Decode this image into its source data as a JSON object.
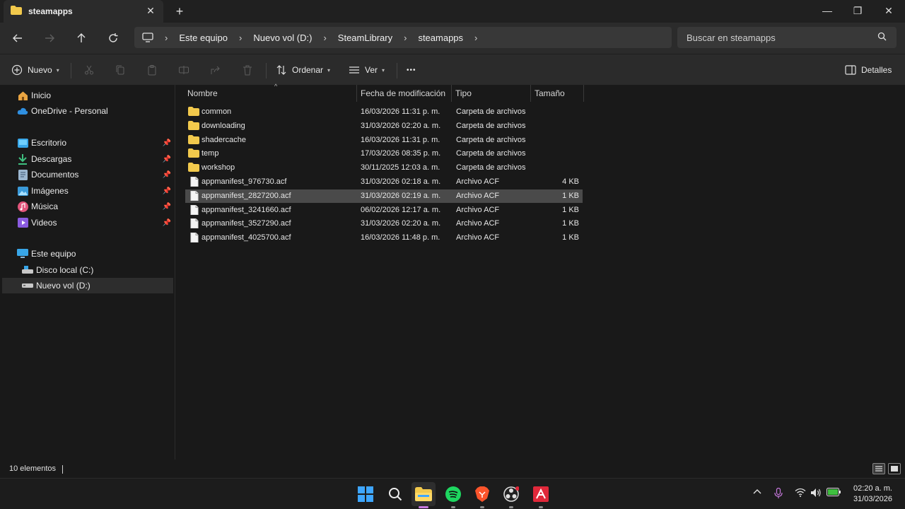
{
  "window": {
    "tab_title": "steamapps",
    "tab_close": "✕",
    "new_tab": "+",
    "minimize": "—",
    "maximize": "❐",
    "close": "✕"
  },
  "nav": {
    "breadcrumb": [
      "Este equipo",
      "Nuevo vol (D:)",
      "SteamLibrary",
      "steamapps"
    ],
    "search_placeholder": "Buscar en steamapps"
  },
  "toolbar": {
    "new_label": "Nuevo",
    "sort_label": "Ordenar",
    "view_label": "Ver",
    "more_label": "•••",
    "details_label": "Detalles"
  },
  "sidebar": {
    "quick": [
      {
        "label": "Inicio",
        "icon": "home-icon"
      },
      {
        "label": "OneDrive - Personal",
        "icon": "cloud-icon"
      }
    ],
    "pinned": [
      {
        "label": "Escritorio",
        "icon": "desktop-icon"
      },
      {
        "label": "Descargas",
        "icon": "download-icon"
      },
      {
        "label": "Documentos",
        "icon": "document-icon"
      },
      {
        "label": "Imágenes",
        "icon": "image-icon"
      },
      {
        "label": "Música",
        "icon": "music-icon"
      },
      {
        "label": "Videos",
        "icon": "video-icon"
      }
    ],
    "this_pc": {
      "label": "Este equipo",
      "icon": "computer-icon"
    },
    "drives": [
      {
        "label": "Disco local (C:)",
        "icon": "drive-icon"
      },
      {
        "label": "Nuevo vol (D:)",
        "icon": "drive-icon",
        "selected": true
      }
    ]
  },
  "columns": {
    "name": "Nombre",
    "date": "Fecha de modificación",
    "type": "Tipo",
    "size": "Tamaño"
  },
  "files": [
    {
      "name": "common",
      "date": "16/03/2026 11:31 p. m.",
      "type": "Carpeta de archivos",
      "size": "",
      "kind": "folder"
    },
    {
      "name": "downloading",
      "date": "31/03/2026 02:20 a. m.",
      "type": "Carpeta de archivos",
      "size": "",
      "kind": "folder"
    },
    {
      "name": "shadercache",
      "date": "16/03/2026 11:31 p. m.",
      "type": "Carpeta de archivos",
      "size": "",
      "kind": "folder"
    },
    {
      "name": "temp",
      "date": "17/03/2026 08:35 p. m.",
      "type": "Carpeta de archivos",
      "size": "",
      "kind": "folder"
    },
    {
      "name": "workshop",
      "date": "30/11/2025 12:03 a. m.",
      "type": "Carpeta de archivos",
      "size": "",
      "kind": "folder"
    },
    {
      "name": "appmanifest_976730.acf",
      "date": "31/03/2026 02:18 a. m.",
      "type": "Archivo ACF",
      "size": "4 KB",
      "kind": "file"
    },
    {
      "name": "appmanifest_2827200.acf",
      "date": "31/03/2026 02:19 a. m.",
      "type": "Archivo ACF",
      "size": "1 KB",
      "kind": "file",
      "selected": true
    },
    {
      "name": "appmanifest_3241660.acf",
      "date": "06/02/2026 12:17 a. m.",
      "type": "Archivo ACF",
      "size": "1 KB",
      "kind": "file"
    },
    {
      "name": "appmanifest_3527290.acf",
      "date": "31/03/2026 02:20 a. m.",
      "type": "Archivo ACF",
      "size": "1 KB",
      "kind": "file"
    },
    {
      "name": "appmanifest_4025700.acf",
      "date": "16/03/2026 11:48 p. m.",
      "type": "Archivo ACF",
      "size": "1 KB",
      "kind": "file"
    }
  ],
  "status": {
    "count": "10 elementos"
  },
  "clock": {
    "time": "02:20 a. m.",
    "date": "31/03/2026"
  },
  "colors": {
    "folder": "#f2c94c",
    "accent": "#c678dd",
    "spotify": "#1ed760",
    "brave": "#fb542b",
    "amd": "#e0283a"
  }
}
